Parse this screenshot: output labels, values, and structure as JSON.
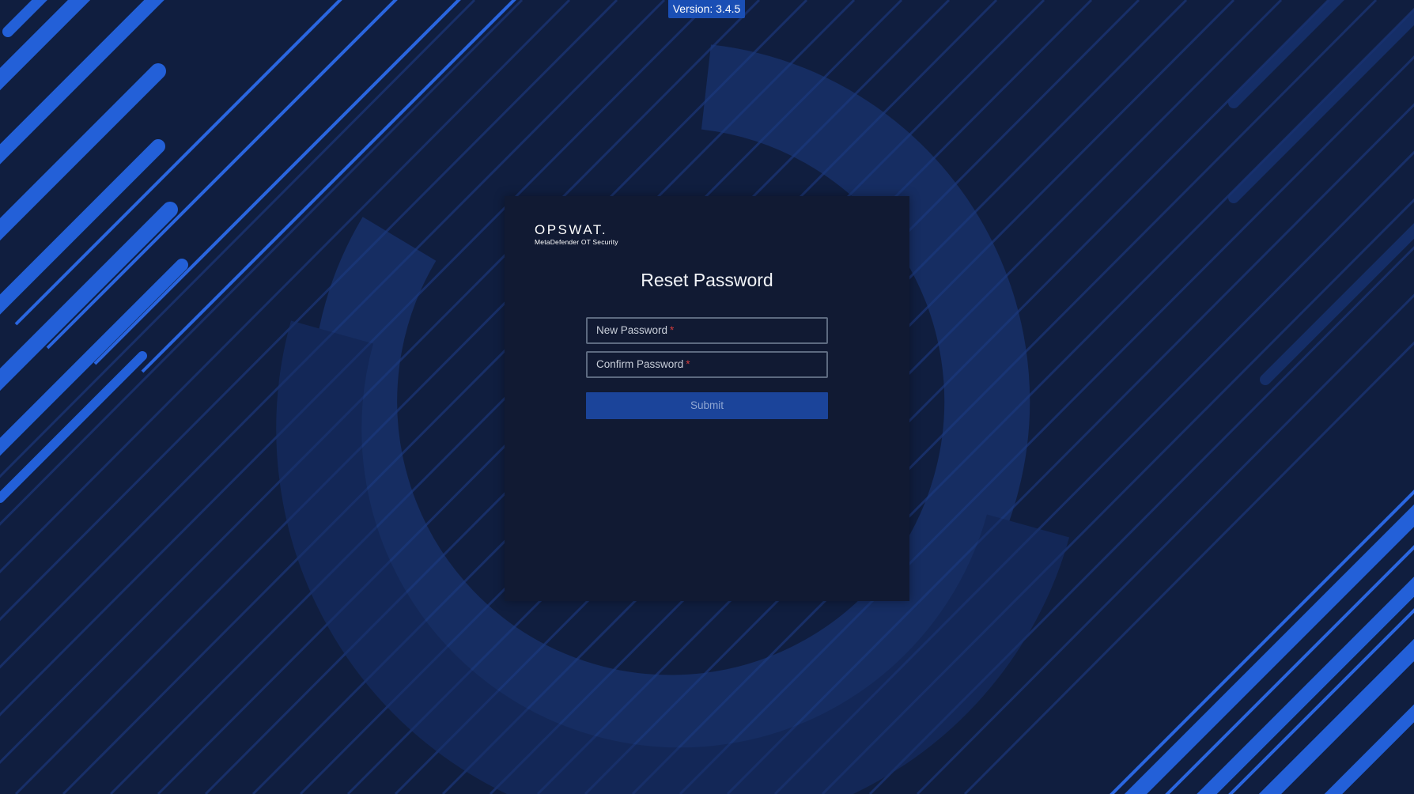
{
  "version": {
    "label": "Version: 3.4.5"
  },
  "brand": {
    "wordmark": "OPSWAT.",
    "product": "MetaDefender OT Security"
  },
  "form": {
    "title": "Reset Password",
    "new_password_label": "New Password",
    "confirm_password_label": "Confirm Password",
    "required_mark": "*",
    "submit_label": "Submit"
  },
  "colors": {
    "background": "#101e3f",
    "accent_blue": "#1f56c9",
    "card": "#111a33",
    "required": "#d23b3b"
  }
}
